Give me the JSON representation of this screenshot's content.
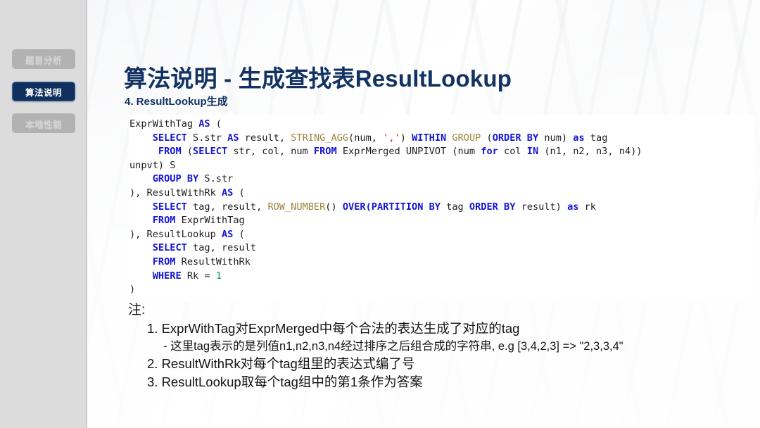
{
  "sidebar": {
    "items": [
      {
        "label": "题目分析",
        "active": false
      },
      {
        "label": "算法说明",
        "active": true
      },
      {
        "label": "本地性能",
        "active": false
      }
    ]
  },
  "header": {
    "title": "算法说明 - 生成查找表ResultLookup",
    "subtitle": "4. ResultLookup生成"
  },
  "code": {
    "language": "sql",
    "lines": [
      [
        {
          "t": "ExprWithTag ",
          "c": "pl"
        },
        {
          "t": "AS",
          "c": "kw"
        },
        {
          "t": " (",
          "c": "pl"
        }
      ],
      [
        {
          "t": "    ",
          "c": "pl"
        },
        {
          "t": "SELECT",
          "c": "kw"
        },
        {
          "t": " S.str ",
          "c": "pl"
        },
        {
          "t": "AS",
          "c": "kw"
        },
        {
          "t": " result, ",
          "c": "pl"
        },
        {
          "t": "STRING_AGG",
          "c": "fn"
        },
        {
          "t": "(num, ",
          "c": "pl"
        },
        {
          "t": "','",
          "c": "str"
        },
        {
          "t": ") ",
          "c": "pl"
        },
        {
          "t": "WITHIN",
          "c": "kw"
        },
        {
          "t": " ",
          "c": "pl"
        },
        {
          "t": "GROUP",
          "c": "fn"
        },
        {
          "t": " (",
          "c": "pl"
        },
        {
          "t": "ORDER BY",
          "c": "kw"
        },
        {
          "t": " num) ",
          "c": "pl"
        },
        {
          "t": "as",
          "c": "kw"
        },
        {
          "t": " tag",
          "c": "pl"
        }
      ],
      [
        {
          "t": "     ",
          "c": "pl"
        },
        {
          "t": "FROM",
          "c": "kw"
        },
        {
          "t": " (",
          "c": "pl"
        },
        {
          "t": "SELECT",
          "c": "kw"
        },
        {
          "t": " str, col, num ",
          "c": "pl"
        },
        {
          "t": "FROM",
          "c": "kw"
        },
        {
          "t": " ExprMerged UNPIVOT (num ",
          "c": "pl"
        },
        {
          "t": "for",
          "c": "kw"
        },
        {
          "t": " col ",
          "c": "pl"
        },
        {
          "t": "IN",
          "c": "kw"
        },
        {
          "t": " (n1, n2, n3, n4))",
          "c": "pl"
        }
      ],
      [
        {
          "t": "unpvt) S",
          "c": "pl"
        }
      ],
      [
        {
          "t": "    ",
          "c": "pl"
        },
        {
          "t": "GROUP BY",
          "c": "kw"
        },
        {
          "t": " S.str",
          "c": "pl"
        }
      ],
      [
        {
          "t": "), ResultWithRk ",
          "c": "pl"
        },
        {
          "t": "AS",
          "c": "kw"
        },
        {
          "t": " (",
          "c": "pl"
        }
      ],
      [
        {
          "t": "    ",
          "c": "pl"
        },
        {
          "t": "SELECT",
          "c": "kw"
        },
        {
          "t": " tag, result, ",
          "c": "pl"
        },
        {
          "t": "ROW_NUMBER",
          "c": "fn"
        },
        {
          "t": "() ",
          "c": "pl"
        },
        {
          "t": "OVER(PARTITION BY",
          "c": "kw"
        },
        {
          "t": " tag ",
          "c": "pl"
        },
        {
          "t": "ORDER BY",
          "c": "kw"
        },
        {
          "t": " result) ",
          "c": "pl"
        },
        {
          "t": "as",
          "c": "kw"
        },
        {
          "t": " rk",
          "c": "pl"
        }
      ],
      [
        {
          "t": "    ",
          "c": "pl"
        },
        {
          "t": "FROM",
          "c": "kw"
        },
        {
          "t": " ExprWithTag",
          "c": "pl"
        }
      ],
      [
        {
          "t": "), ResultLookup ",
          "c": "pl"
        },
        {
          "t": "AS",
          "c": "kw"
        },
        {
          "t": " (",
          "c": "pl"
        }
      ],
      [
        {
          "t": "    ",
          "c": "pl"
        },
        {
          "t": "SELECT",
          "c": "kw"
        },
        {
          "t": " tag, result",
          "c": "pl"
        }
      ],
      [
        {
          "t": "    ",
          "c": "pl"
        },
        {
          "t": "FROM",
          "c": "kw"
        },
        {
          "t": " ResultWithRk",
          "c": "pl"
        }
      ],
      [
        {
          "t": "    ",
          "c": "pl"
        },
        {
          "t": "WHERE",
          "c": "kw"
        },
        {
          "t": " Rk = ",
          "c": "pl"
        },
        {
          "t": "1",
          "c": "num"
        }
      ],
      [
        {
          "t": ")",
          "c": "pl"
        }
      ]
    ]
  },
  "notes": {
    "label": "注:",
    "items": [
      {
        "text": "1. ExprWithTag对ExprMerged中每个合法的表达生成了对应的tag",
        "sub": "- 这里tag表示的是列值n1,n2,n3,n4经过排序之后组合成的字符串, e.g [3,4,2,3] => \"2,3,3,4\""
      },
      {
        "text": "2. ResultWithRk对每个tag组里的表达式编了号",
        "sub": null
      },
      {
        "text": "3. ResultLookup取每个tag组中的第1条作为答案",
        "sub": null
      }
    ]
  },
  "theme": {
    "accent_navy": "#123262",
    "pill_active_bg": "#11305e",
    "pill_inactive_bg": "#b2b2b2",
    "sidebar_bg": "#dcdcdc",
    "keyword_color": "#1414d6",
    "function_color": "#9a8540",
    "string_color": "#c62828",
    "number_color": "#0f9d58"
  }
}
